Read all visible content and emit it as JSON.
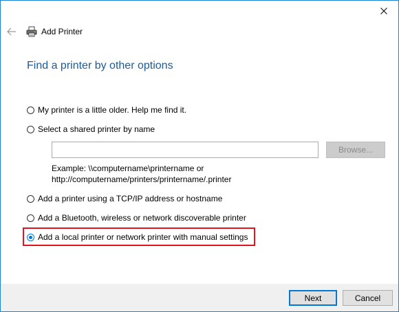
{
  "window": {
    "title": "Add Printer"
  },
  "page": {
    "heading": "Find a printer by other options"
  },
  "options": [
    {
      "label": "My printer is a little older. Help me find it.",
      "checked": false
    },
    {
      "label": "Select a shared printer by name",
      "checked": false
    },
    {
      "label": "Add a printer using a TCP/IP address or hostname",
      "checked": false
    },
    {
      "label": "Add a Bluetooth, wireless or network discoverable printer",
      "checked": false
    },
    {
      "label": "Add a local printer or network printer with manual settings",
      "checked": true
    }
  ],
  "shared_printer": {
    "value": "",
    "browse_label": "Browse...",
    "example_line1": "Example: \\\\computername\\printername or",
    "example_line2": "http://computername/printers/printername/.printer"
  },
  "footer": {
    "next_label": "Next",
    "cancel_label": "Cancel"
  },
  "colors": {
    "accent": "#0078d7",
    "heading": "#1c5a96",
    "highlight": "#e0141e",
    "footer_bg": "#f0f0f0"
  }
}
